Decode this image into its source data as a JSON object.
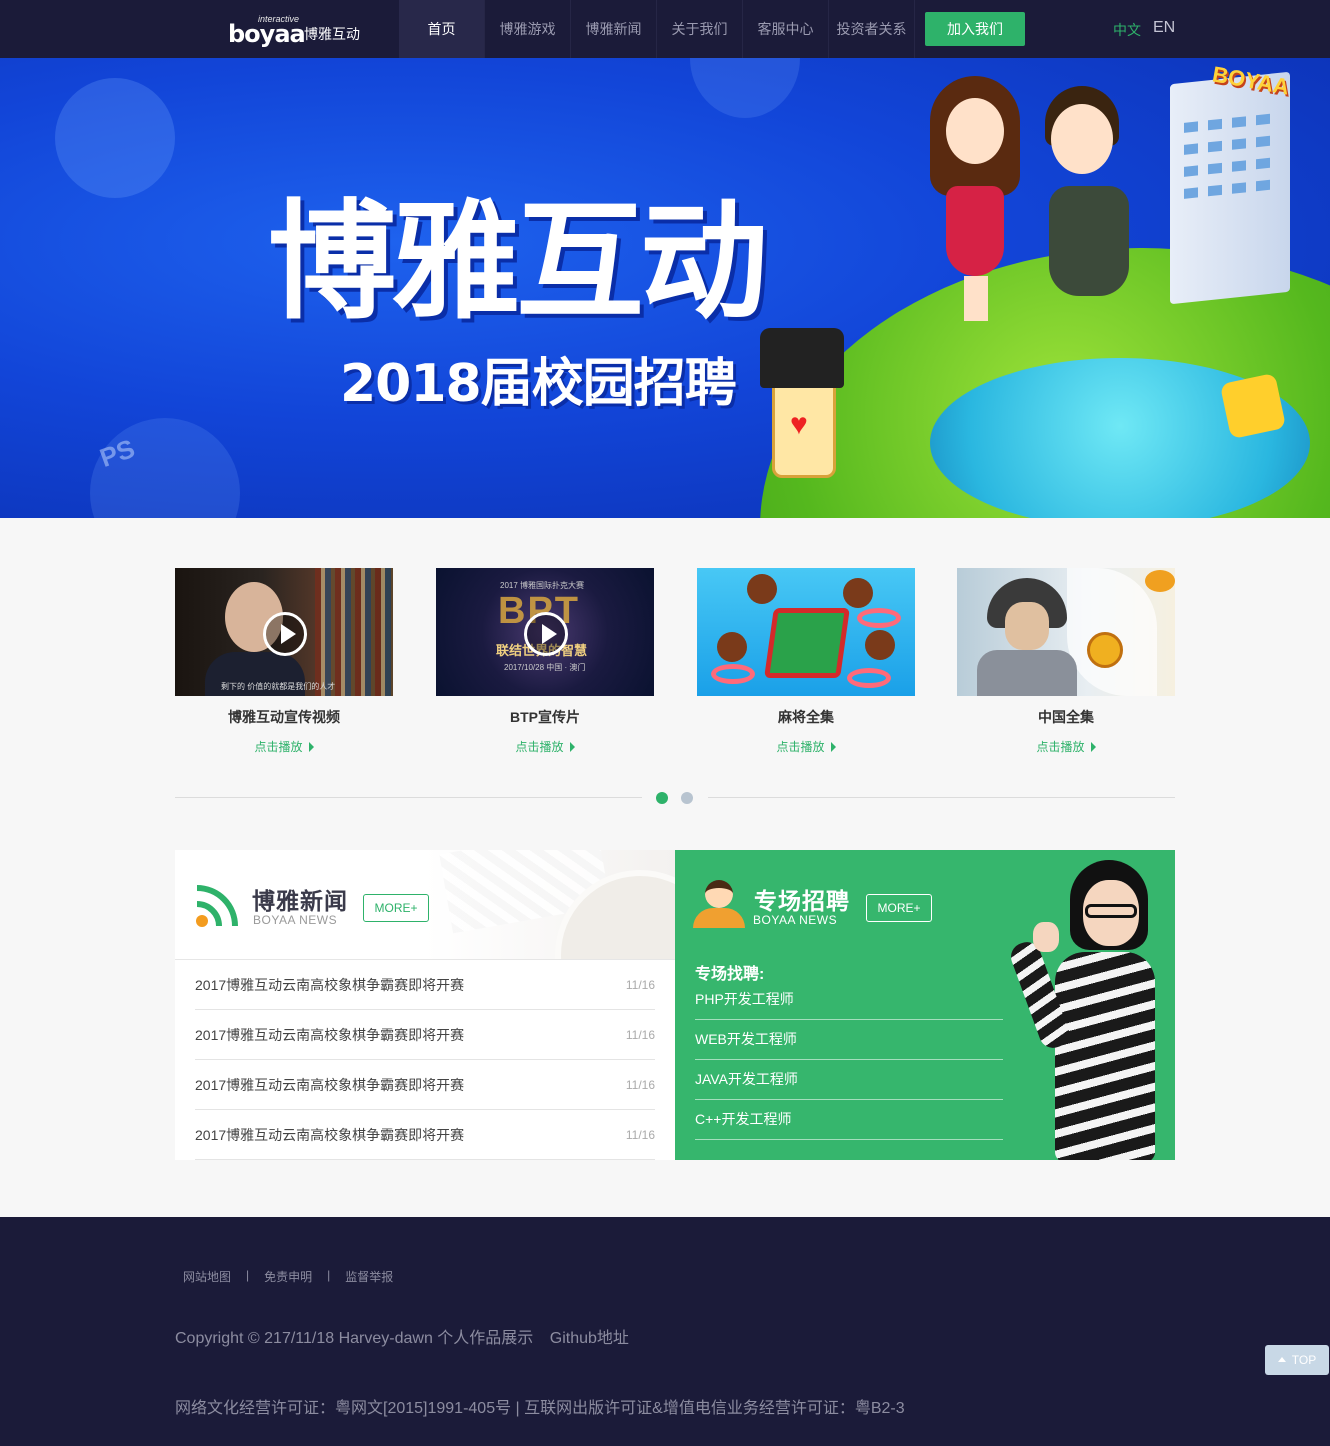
{
  "header": {
    "logo_small": "interactive",
    "logo_word": "boyaa",
    "logo_cn": "博雅互动",
    "nav": [
      "首页",
      "博雅游戏",
      "博雅新闻",
      "关于我们",
      "客服中心",
      "投资者关系"
    ],
    "join_label": "加入我们",
    "lang_cn": "中文",
    "lang_en": "EN",
    "accent": "#2eb26a"
  },
  "banner": {
    "title": "博雅互动",
    "subtitle": "2018届校园招聘",
    "sign": "BOYAA",
    "ps_label": "PS",
    "slide_count": 5,
    "active_slide": 1
  },
  "videos": [
    {
      "title": "博雅互动宣传视频",
      "play_label": "点击播放",
      "caption": "剩下的 价值的就都是我们的人才"
    },
    {
      "title": "BTP宣传片",
      "play_label": "点击播放",
      "top": "2017 博雅国际扑克大赛",
      "big": "BPT",
      "line": "联结世界的智慧",
      "bot": "2017/10/28 中国 · 澳门"
    },
    {
      "title": "麻将全集",
      "play_label": "点击播放"
    },
    {
      "title": "中国全集",
      "play_label": "点击播放"
    }
  ],
  "video_pager": {
    "count": 2,
    "active": 1,
    "active_color": "#2eb26a",
    "inactive_color": "#b8c4d0"
  },
  "news": {
    "title": "博雅新闻",
    "subtitle": "BOYAA NEWS",
    "more": "MORE+",
    "items": [
      {
        "title": "2017博雅互动云南高校象棋争霸赛即将开赛",
        "date": "11/16"
      },
      {
        "title": "2017博雅互动云南高校象棋争霸赛即将开赛",
        "date": "11/16"
      },
      {
        "title": "2017博雅互动云南高校象棋争霸赛即将开赛",
        "date": "11/16"
      },
      {
        "title": "2017博雅互动云南高校象棋争霸赛即将开赛",
        "date": "11/16"
      }
    ]
  },
  "jobs": {
    "title": "专场招聘",
    "subtitle": "BOYAA NEWS",
    "more": "MORE+",
    "label": "专场找聘:",
    "items": [
      "PHP开发工程师",
      "WEB开发工程师",
      "JAVA开发工程师",
      "C++开发工程师"
    ],
    "bg": "#36b66d"
  },
  "footer": {
    "links": [
      "网站地图",
      "免责申明",
      "监督举报"
    ],
    "separator": "|",
    "copyright": "Copyright © 217/11/18 Harvey-dawn 个人作品展示",
    "github": "Github地址",
    "license": "网络文化经营许可证：粤网文[2015]1991-405号 | 互联网出版许可证&增值电信业务经营许可证：粤B2-3",
    "top_label": "TOP"
  }
}
